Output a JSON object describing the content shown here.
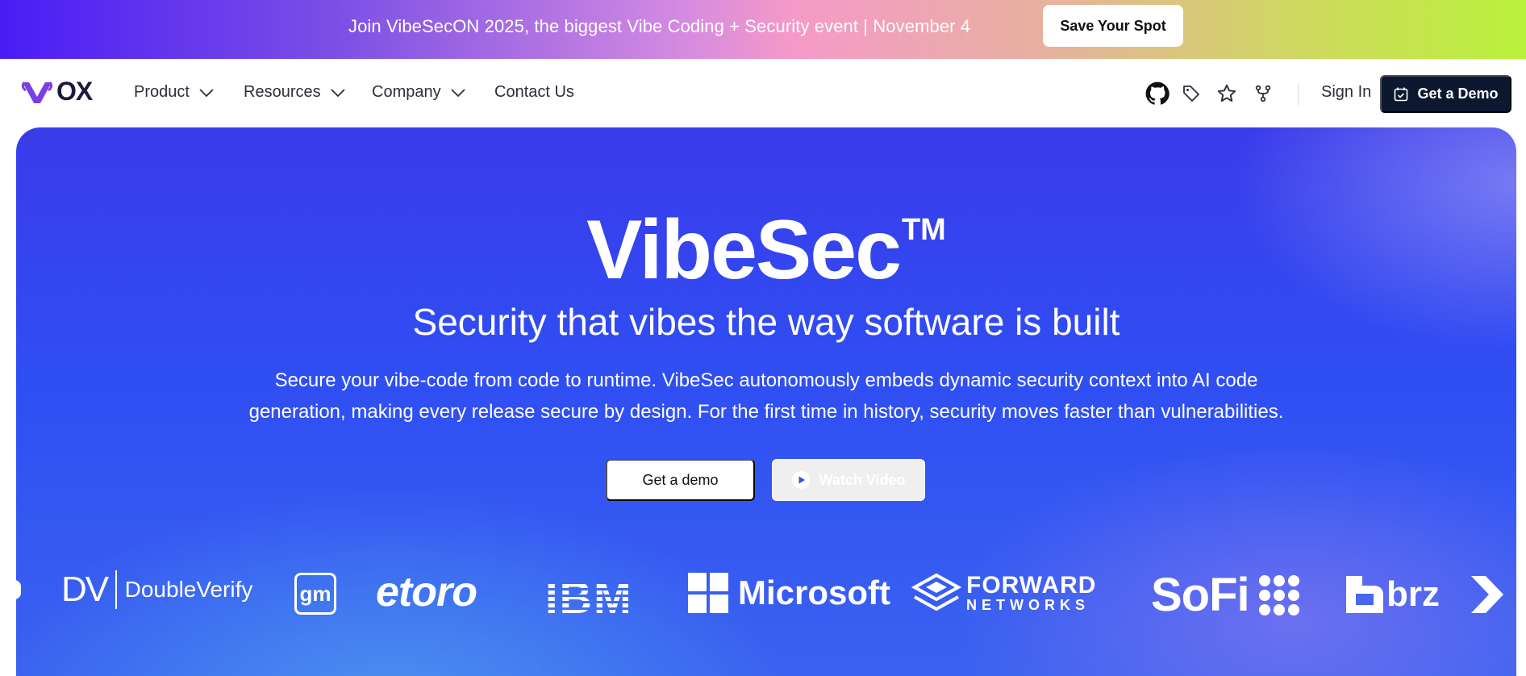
{
  "banner": {
    "text": "Join VibeSecON 2025, the biggest Vibe Coding + Security event | November 4",
    "cta": "Save Your Spot"
  },
  "nav": {
    "logo_text": "OX",
    "items": [
      {
        "label": "Product",
        "has_dropdown": true
      },
      {
        "label": "Resources",
        "has_dropdown": true
      },
      {
        "label": "Company",
        "has_dropdown": true
      },
      {
        "label": "Contact Us",
        "has_dropdown": false
      }
    ],
    "icons": [
      "github-icon",
      "tag-icon",
      "star-icon",
      "fork-icon"
    ],
    "sign_in": "Sign In",
    "demo_button": "Get a Demo"
  },
  "hero": {
    "title": "VibeSec",
    "trademark": "TM",
    "subtitle": "Security that vibes the way software is built",
    "description_line1": "Secure your vibe-code from code to runtime. VibeSec autonomously embeds dynamic security context into AI code",
    "description_line2": "generation, making every release secure by design. For the first time in history, security moves faster than vulnerabilities.",
    "primary_button": "Get a demo",
    "secondary_button": "Watch Video"
  },
  "customers": {
    "logos": [
      {
        "mark": "DV",
        "name": "DoubleVerify"
      },
      {
        "mark": "gm"
      },
      {
        "name": "eToro",
        "text": "etoro"
      },
      {
        "name": "IBM",
        "text": "IBM"
      },
      {
        "name": "Microsoft",
        "text": "Microsoft"
      },
      {
        "name": "Forward Networks",
        "line1": "FORWARD",
        "line2": "NETWORKS"
      },
      {
        "name": "SoFi",
        "text": "SoFi"
      },
      {
        "name": "brz",
        "text": "brz"
      }
    ]
  },
  "colors": {
    "nav_dark_button": "#0d1830",
    "hero_blue": "#2f4ef3",
    "logo_purple": "#7b3fe4"
  }
}
